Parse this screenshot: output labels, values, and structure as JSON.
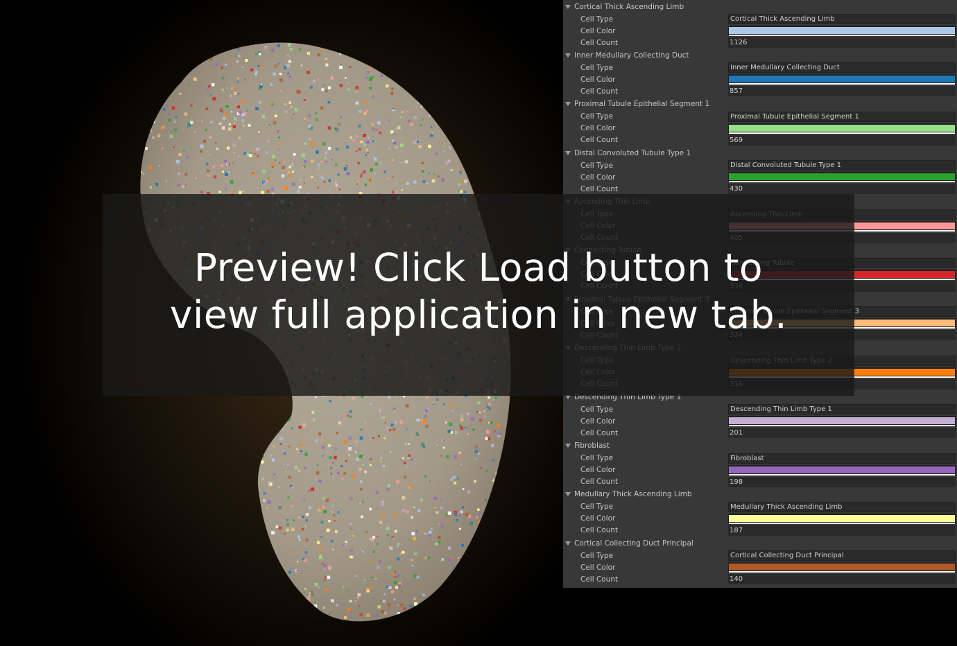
{
  "viewport": {
    "dot_colors": [
      "#aec7e8",
      "#1f77b4",
      "#98df8a",
      "#2ca02c",
      "#ff9896",
      "#d62728",
      "#ffbb78",
      "#ff7f0e",
      "#c5b0d5",
      "#9467bd",
      "#ffff99",
      "#b15928",
      "#ffffff"
    ]
  },
  "inspector": {
    "labels": {
      "cell_type": "Cell Type",
      "cell_color": "Cell Color",
      "cell_count": "Cell Count"
    },
    "sections": [
      {
        "title": "Cortical Thick Ascending Limb",
        "cell_type": "Cortical Thick Ascending Limb",
        "color": "#aec7e8",
        "count": "1126"
      },
      {
        "title": "Inner Medullary Collecting Duct",
        "cell_type": "Inner Medullary Collecting Duct",
        "color": "#1f77b4",
        "count": "857"
      },
      {
        "title": "Proximal Tubule Epithelial Segment 1",
        "cell_type": "Proximal Tubule Epithelial Segment 1",
        "color": "#98df8a",
        "count": "569"
      },
      {
        "title": "Distal Convoluted Tubule Type 1",
        "cell_type": "Distal Convoluted Tubule Type 1",
        "color": "#2ca02c",
        "count": "430"
      },
      {
        "title": "Ascending Thin Limb",
        "cell_type": "Ascending Thin Limb",
        "color": "#ff9896",
        "count": "405"
      },
      {
        "title": "Connecting Tubule",
        "cell_type": "Connecting Tubule",
        "color": "#d62728",
        "count": "338"
      },
      {
        "title": "Proximal Tubule Epithelial Segment 3",
        "cell_type": "Proximal Tubule Epithelial Segment 3",
        "color": "#ffbb78",
        "count": "334"
      },
      {
        "title": "Descending Thin Limb Type 2",
        "cell_type": "Descending Thin Limb Type 2",
        "color": "#ff7f0e",
        "count": "316"
      },
      {
        "title": "Descending Thin Limb Type 1",
        "cell_type": "Descending Thin Limb Type 1",
        "color": "#c5b0d5",
        "count": "201"
      },
      {
        "title": "Fibroblast",
        "cell_type": "Fibroblast",
        "color": "#9467bd",
        "count": "198"
      },
      {
        "title": "Medullary Thick Ascending Limb",
        "cell_type": "Medullary Thick Ascending Limb",
        "color": "#ffff99",
        "count": "187"
      },
      {
        "title": "Cortical Collecting Duct Principal",
        "cell_type": "Cortical Collecting Duct Principal",
        "color": "#b15928",
        "count": "140"
      }
    ]
  },
  "banner": {
    "line1": "Preview! Click Load button to",
    "line2": "view full application in new tab."
  }
}
